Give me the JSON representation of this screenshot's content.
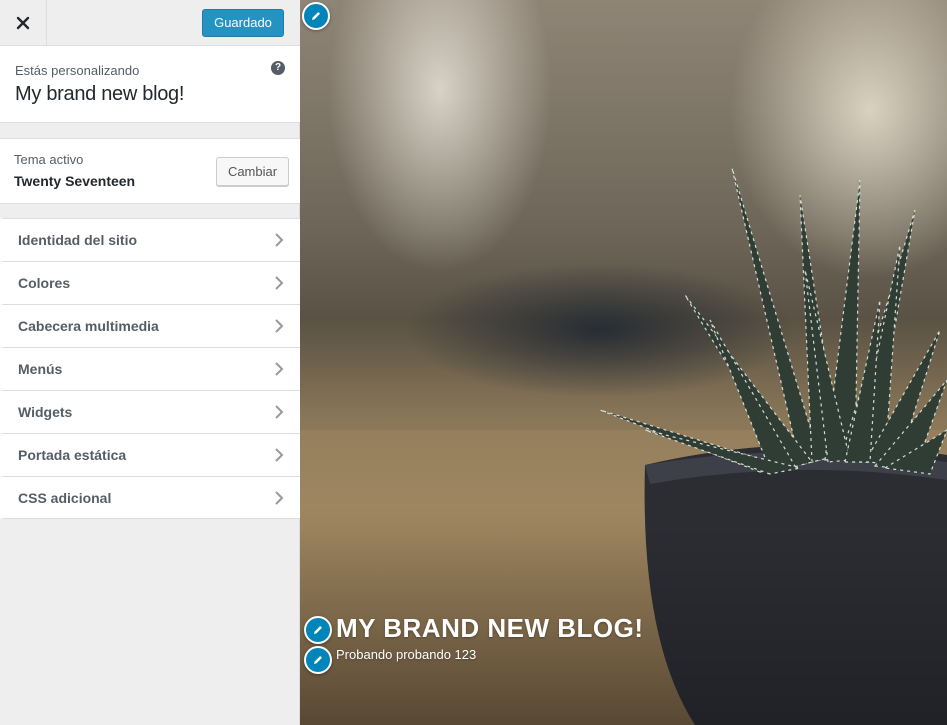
{
  "header": {
    "close_icon": "close-icon",
    "save_label": "Guardado"
  },
  "info": {
    "subtitle": "Estás personalizando",
    "title": "My brand new blog!",
    "help_icon": "help-icon",
    "help_glyph": "?"
  },
  "theme": {
    "subtitle": "Tema activo",
    "name": "Twenty Seventeen",
    "change_label": "Cambiar"
  },
  "menu": {
    "items": [
      {
        "label": "Identidad del sitio"
      },
      {
        "label": "Colores"
      },
      {
        "label": "Cabecera multimedia"
      },
      {
        "label": "Menús"
      },
      {
        "label": "Widgets"
      },
      {
        "label": "Portada estática"
      },
      {
        "label": "CSS adicional"
      }
    ],
    "chevron_icon": "chevron-right-icon"
  },
  "preview": {
    "site_title": "MY BRAND NEW BLOG!",
    "tagline": "Probando probando 123",
    "edit_icon": "pencil-icon"
  },
  "colors": {
    "accent": "#0085ba",
    "sidebar_bg": "#eeeeee"
  }
}
